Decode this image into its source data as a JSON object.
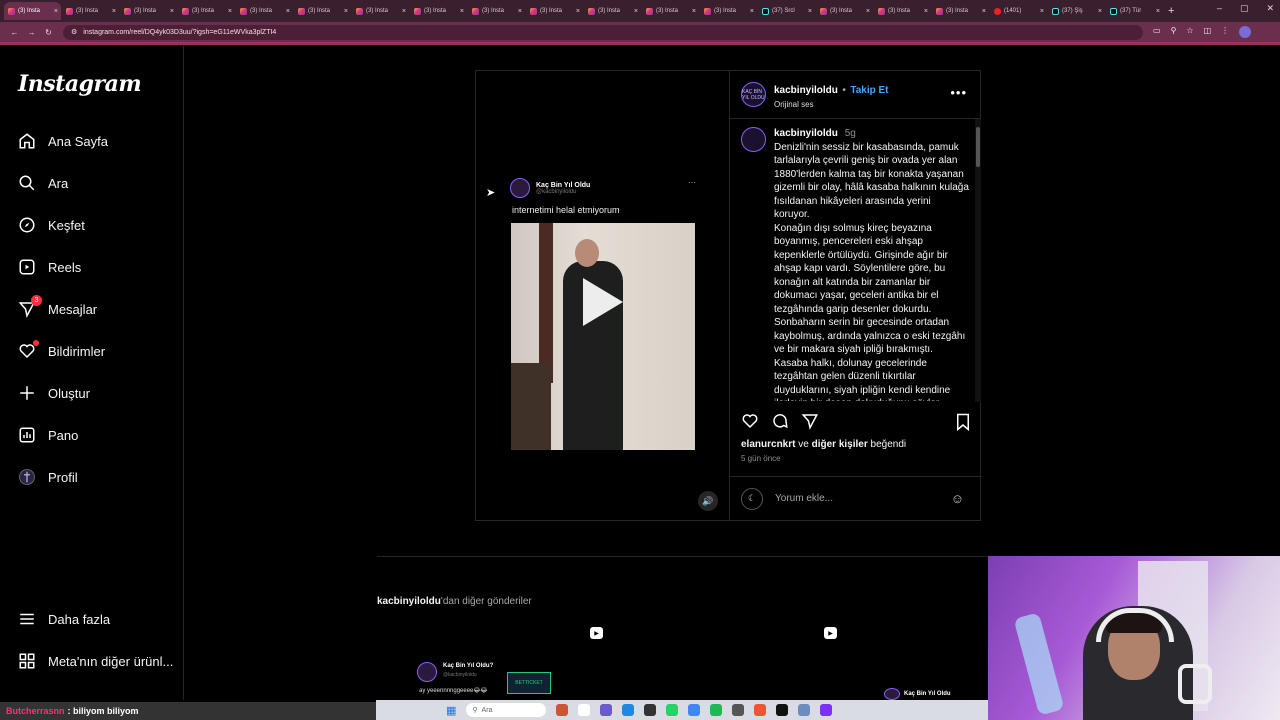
{
  "browser": {
    "tabs": [
      {
        "label": "(3) Insta",
        "icon": "instagram-icon",
        "active": true
      },
      {
        "label": "(3) Insta",
        "icon": "instagram-icon"
      },
      {
        "label": "(3) Insta",
        "icon": "instagram-icon"
      },
      {
        "label": "(3) Insta",
        "icon": "instagram-icon"
      },
      {
        "label": "(3) Insta",
        "icon": "instagram-icon"
      },
      {
        "label": "(3) Insta",
        "icon": "instagram-icon"
      },
      {
        "label": "(3) Insta",
        "icon": "instagram-icon"
      },
      {
        "label": "(3) Insta",
        "icon": "instagram-icon"
      },
      {
        "label": "(3) Insta",
        "icon": "instagram-icon"
      },
      {
        "label": "(3) Insta",
        "icon": "instagram-icon"
      },
      {
        "label": "(3) Insta",
        "icon": "instagram-icon"
      },
      {
        "label": "(3) Insta",
        "icon": "instagram-icon"
      },
      {
        "label": "(3) Insta",
        "icon": "instagram-icon"
      },
      {
        "label": "(37) Srcl",
        "icon": "tiktok-icon"
      },
      {
        "label": "(3) Insta",
        "icon": "instagram-icon"
      },
      {
        "label": "(3) Insta",
        "icon": "instagram-icon"
      },
      {
        "label": "(3) Insta",
        "icon": "instagram-icon"
      },
      {
        "label": "(1401) ",
        "icon": "youtube-icon"
      },
      {
        "label": "(37) Şiş",
        "icon": "tiktok-icon"
      },
      {
        "label": "(37) Tür",
        "icon": "tiktok-icon"
      }
    ],
    "url": "instagram.com/reel/DQ4yk03D3uu/?igsh=eG11eWVka3plZTI4"
  },
  "sidebar": {
    "logo": "Instagram",
    "items": [
      {
        "label": "Ana Sayfa",
        "icon": "home-icon"
      },
      {
        "label": "Ara",
        "icon": "search-icon"
      },
      {
        "label": "Keşfet",
        "icon": "compass-icon"
      },
      {
        "label": "Reels",
        "icon": "reels-icon"
      },
      {
        "label": "Mesajlar",
        "icon": "messenger-icon",
        "badge": "3"
      },
      {
        "label": "Bildirimler",
        "icon": "heart-icon"
      },
      {
        "label": "Oluştur",
        "icon": "plus-icon"
      },
      {
        "label": "Pano",
        "icon": "dashboard-icon"
      },
      {
        "label": "Profil",
        "icon": "profile-avatar-icon"
      }
    ],
    "bottom": [
      {
        "label": "Daha fazla",
        "icon": "menu-icon"
      },
      {
        "label": "Meta'nın diğer ürünl...",
        "icon": "meta-apps-icon"
      }
    ]
  },
  "post": {
    "media": {
      "tweet_name": "Kaç Bin Yıl Oldu",
      "tweet_handle": "@kacbinyiloldu",
      "tweet_text": "internetimi helal etmiyorum"
    },
    "author": "kacbinyiloldu",
    "separator": "•",
    "follow_label": "Takip Et",
    "audio": "Orijinal ses",
    "avatar_text": "KAÇ BİN YIL OLDU",
    "caption_time": "5g",
    "caption": "Denizli'nin sessiz bir kasabasında, pamuk tarlalarıyla çevrili geniş bir ovada yer alan 1880'lerden kalma taş bir konakta yaşanan gizemli bir olay, hâlâ kasaba halkının kulağa fısıldanan hikâyeleri arasında yerini koruyor.\nKonağın dışı solmuş kireç beyazına boyanmış, pencereleri eski ahşap kepenklerle örtülüydü. Girişinde ağır bir ahşap kapı vardı. Söylentilere göre, bu konağın alt katında bir zamanlar bir dokumacı yaşar, geceleri antika bir el tezgâhında garip desenler dokurdu. Sonbaharın serin bir gecesinde ortadan kaybolmuş, ardında yalnızca o eski tezgâhı ve bir makara siyah ipliği bırakmıştı. Kasaba halkı, dolunay gecelerinde tezgâhtan gelen düzenli tıkırtılar duyduklarını, siyah ipliğin kendi kendine ilerleyip bir desen dokuduğunu söyler.",
    "likes_user": "elanurcnkrt",
    "likes_mid": " ve ",
    "likes_others": "diğer kişiler",
    "likes_end": " beğendi",
    "time_ago": "5 gün önce",
    "comment_placeholder": "Yorum ekle..."
  },
  "more_posts": {
    "user": "kacbinyiloldu",
    "suffix": "'dan diğer gönderiler",
    "thumb1_name": "Kaç Bin Yıl Oldu?",
    "thumb1_handle": "@kacbinyiloldu",
    "thumb1_text": "ay yeeennnnggeeee😂😂",
    "thumb1_logo": "BETTICKET",
    "thumb2_name": "Kaç Bin Yıl Oldu"
  },
  "stream": {
    "chat_user": "Butcherrasnn",
    "chat_msg": ": biliyom biliyom"
  },
  "taskbar": {
    "search_placeholder": "Ara"
  },
  "colors": {
    "accent": "#4aa3ff",
    "badge": "#ff3040",
    "tab_active": "#6b2f4d"
  }
}
